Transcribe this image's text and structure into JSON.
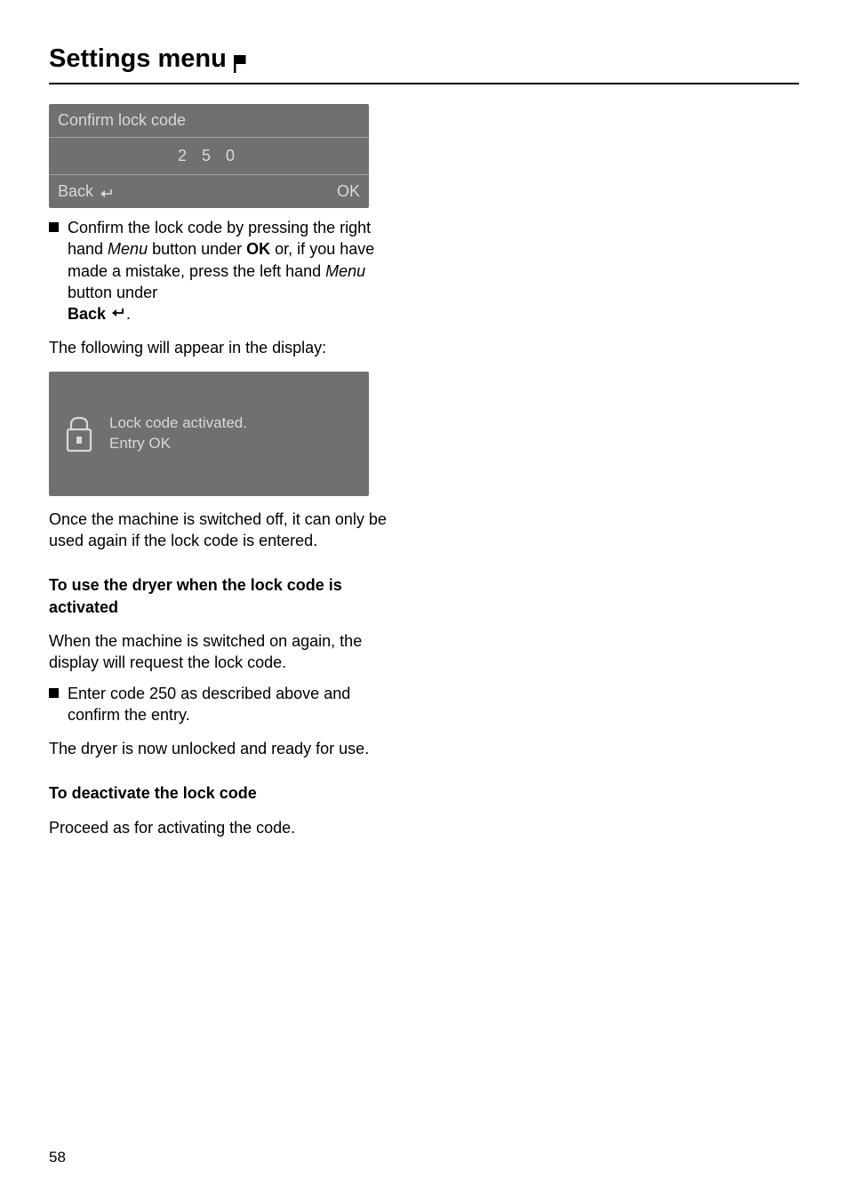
{
  "heading": "Settings menu",
  "display1": {
    "title": "Confirm lock code",
    "code": "2 5 0",
    "back": "Back",
    "ok": "OK"
  },
  "bullet1": {
    "pre1": "Confirm the lock code by pressing the right hand ",
    "menu": "Menu",
    "mid1": " button under ",
    "ok": "OK",
    "mid2": " or, if you have made a mistake, press the left hand ",
    "mid3": " button under ",
    "back": "Back ",
    "end": "."
  },
  "para1": "The following will appear in the display:",
  "display2": {
    "line1": "Lock code activated.",
    "line2": "Entry OK"
  },
  "para2": "Once the machine is switched off, it can only be used again if the lock code is entered.",
  "subhead1": "To use the dryer when the lock code is activated",
  "para3": "When the machine is switched on again, the display will request the lock code.",
  "bullet2": "Enter code 250 as described above and confirm the entry.",
  "para4": "The dryer is now unlocked and ready for use.",
  "subhead2": "To deactivate the lock code",
  "para5": "Proceed as for activating the code.",
  "pageNumber": "58"
}
